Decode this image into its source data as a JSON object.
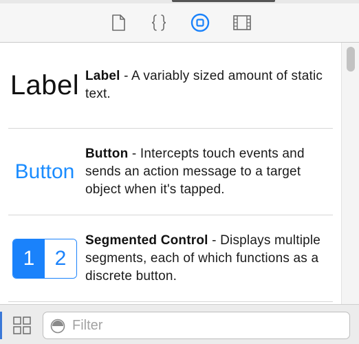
{
  "inspector_tabs": [
    {
      "name": "file-inspector",
      "icon": "document-icon",
      "active": false
    },
    {
      "name": "quick-help",
      "icon": "braces-icon",
      "active": false
    },
    {
      "name": "object-library",
      "icon": "circle-square-icon",
      "active": true
    },
    {
      "name": "media-library",
      "icon": "film-icon",
      "active": false
    }
  ],
  "accent_color": "#1a82fb",
  "library": {
    "items": [
      {
        "preview": "Label",
        "title": "Label",
        "description": " - A variably sized amount of static text."
      },
      {
        "preview": "Button",
        "title": "Button",
        "description": " - Intercepts touch events and sends an action message to a target object when it's tapped."
      },
      {
        "preview_segments": [
          "1",
          "2"
        ],
        "title": "Segmented Control",
        "description": " - Displays multiple segments, each of which functions as a discrete button."
      }
    ]
  },
  "filter": {
    "placeholder": "Filter",
    "value": ""
  }
}
